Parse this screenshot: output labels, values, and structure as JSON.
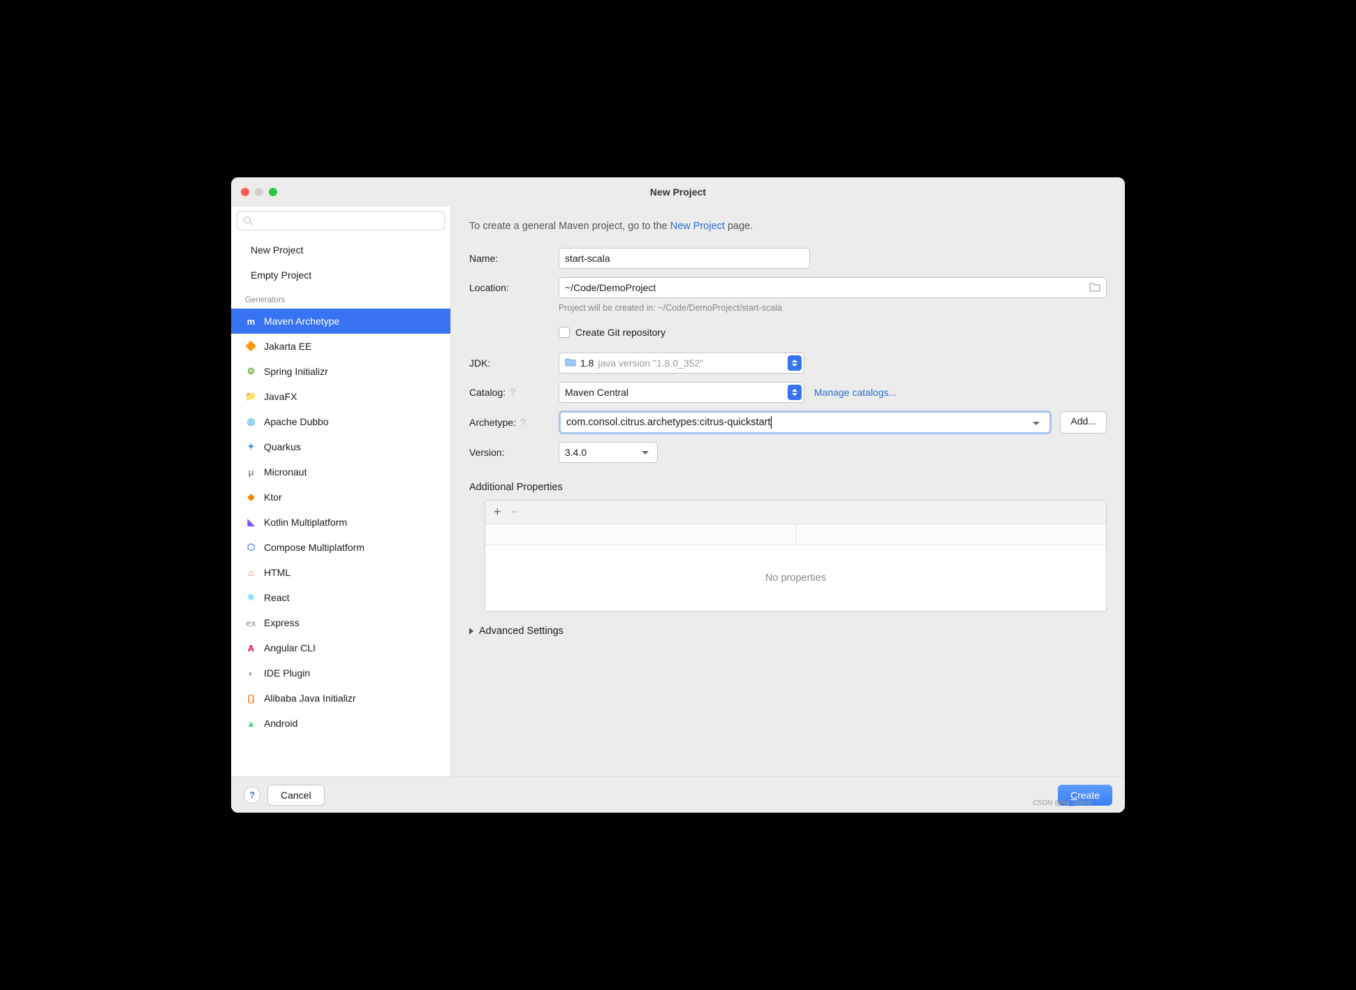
{
  "window": {
    "title": "New Project"
  },
  "sidebar": {
    "search_placeholder": "",
    "top_items": [
      "New Project",
      "Empty Project"
    ],
    "section_label": "Generators",
    "generators": [
      {
        "label": "Maven Archetype",
        "icon": "m",
        "color": "#3874f2",
        "selected": true
      },
      {
        "label": "Jakarta EE",
        "icon": "🔶",
        "color": "#d97a00"
      },
      {
        "label": "Spring Initializr",
        "icon": "⚙",
        "color": "#6db33f"
      },
      {
        "label": "JavaFX",
        "icon": "📁",
        "color": "#8aa0bb"
      },
      {
        "label": "Apache Dubbo",
        "icon": "◎",
        "color": "#29abe2"
      },
      {
        "label": "Quarkus",
        "icon": "✦",
        "color": "#4695eb"
      },
      {
        "label": "Micronaut",
        "icon": "μ",
        "color": "#888"
      },
      {
        "label": "Ktor",
        "icon": "◆",
        "color": "#f18701"
      },
      {
        "label": "Kotlin Multiplatform",
        "icon": "◣",
        "color": "#7f52ff"
      },
      {
        "label": "Compose Multiplatform",
        "icon": "⬡",
        "color": "#4285f4"
      },
      {
        "label": "HTML",
        "icon": "⌂",
        "color": "#e44d26"
      },
      {
        "label": "React",
        "icon": "⚛",
        "color": "#61dafb"
      },
      {
        "label": "Express",
        "icon": "ex",
        "color": "#aaa"
      },
      {
        "label": "Angular CLI",
        "icon": "A",
        "color": "#dd0031"
      },
      {
        "label": "IDE Plugin",
        "icon": "◐",
        "color": "#999"
      },
      {
        "label": "Alibaba Java Initializr",
        "icon": "〔〕",
        "color": "#ff6a00"
      },
      {
        "label": "Android",
        "icon": "▲",
        "color": "#3ddc84"
      }
    ]
  },
  "main": {
    "intro_prefix": "To create a general Maven project, go to the ",
    "intro_link": "New Project",
    "intro_suffix": " page.",
    "labels": {
      "name": "Name:",
      "location": "Location:",
      "jdk": "JDK:",
      "catalog": "Catalog:",
      "archetype": "Archetype:",
      "version": "Version:",
      "additional_props": "Additional Properties",
      "advanced": "Advanced Settings"
    },
    "name_value": "start-scala",
    "location_value": "~/Code/DemoProject",
    "location_hint": "Project will be created in: ~/Code/DemoProject/start-scala",
    "git_checkbox_label": "Create Git repository",
    "jdk": {
      "version": "1.8",
      "description": "java version \"1.8.0_352\""
    },
    "catalog_value": "Maven Central",
    "manage_catalogs": "Manage catalogs...",
    "archetype_value": "com.consol.citrus.archetypes:citrus-quickstart",
    "add_button": "Add...",
    "version_value": "3.4.0",
    "props_empty": "No properties"
  },
  "footer": {
    "cancel": "Cancel",
    "create": "Create"
  },
  "watermark": "CSDN @ha_lydms"
}
